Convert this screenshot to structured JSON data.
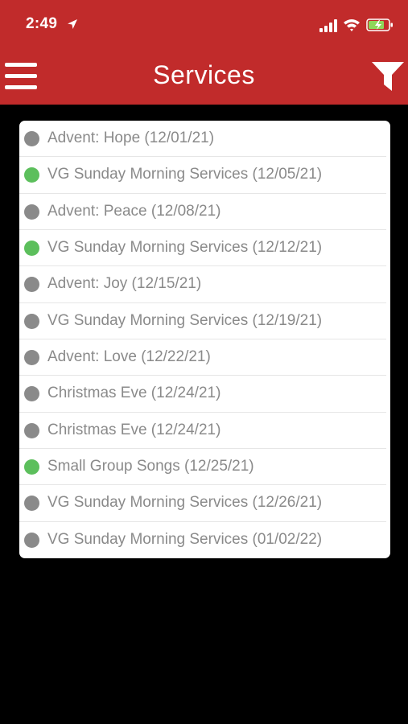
{
  "status_bar": {
    "time": "2:49",
    "icons": [
      "location-arrow-icon",
      "cellular-signal-icon",
      "wifi-icon",
      "battery-charging-icon"
    ]
  },
  "header": {
    "title": "Services",
    "left_icon": "menu-icon",
    "right_icon": "filter-icon"
  },
  "colors": {
    "header_bg": "#c12b2b",
    "active_dot": "#5cbf5c",
    "inactive_dot": "#8a8a8a",
    "text": "#8a8a8a",
    "background": "#000000"
  },
  "services": [
    {
      "label": "Advent: Hope (12/01/21)",
      "status": "inactive"
    },
    {
      "label": "VG Sunday Morning Services (12/05/21)",
      "status": "active"
    },
    {
      "label": "Advent: Peace (12/08/21)",
      "status": "inactive"
    },
    {
      "label": "VG Sunday Morning Services (12/12/21)",
      "status": "active"
    },
    {
      "label": "Advent: Joy (12/15/21)",
      "status": "inactive"
    },
    {
      "label": "VG Sunday Morning Services (12/19/21)",
      "status": "inactive"
    },
    {
      "label": "Advent: Love (12/22/21)",
      "status": "inactive"
    },
    {
      "label": "Christmas Eve (12/24/21)",
      "status": "inactive"
    },
    {
      "label": "Christmas Eve (12/24/21)",
      "status": "inactive"
    },
    {
      "label": "Small Group Songs (12/25/21)",
      "status": "active"
    },
    {
      "label": "VG Sunday Morning Services (12/26/21)",
      "status": "inactive"
    },
    {
      "label": "VG Sunday Morning Services (01/02/22)",
      "status": "inactive"
    }
  ]
}
